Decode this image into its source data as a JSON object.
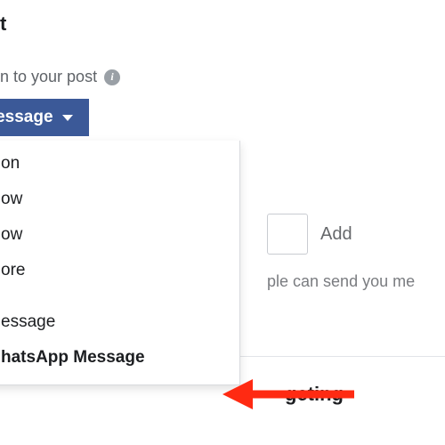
{
  "header": {
    "title_fragment": "t"
  },
  "subhead": {
    "text_fragment": "n to your post"
  },
  "cta": {
    "label_fragment": "hatsApp Message"
  },
  "dropdown": {
    "items": [
      {
        "label_fragment": "on",
        "bold": false
      },
      {
        "label_fragment": "ow",
        "bold": false
      },
      {
        "label_fragment": "ow",
        "bold": false
      },
      {
        "label_fragment": "ore",
        "bold": false
      }
    ],
    "group2": [
      {
        "label_fragment": "essage",
        "bold": false
      },
      {
        "label_fragment": "hatsApp Message",
        "bold": true
      }
    ]
  },
  "right": {
    "add_label": "Add",
    "hint_fragment": "ple can send you me"
  },
  "bottom": {
    "bold_fragment": "geting"
  },
  "colors": {
    "brand": "#3b5998",
    "arrow": "#ff2a12"
  }
}
